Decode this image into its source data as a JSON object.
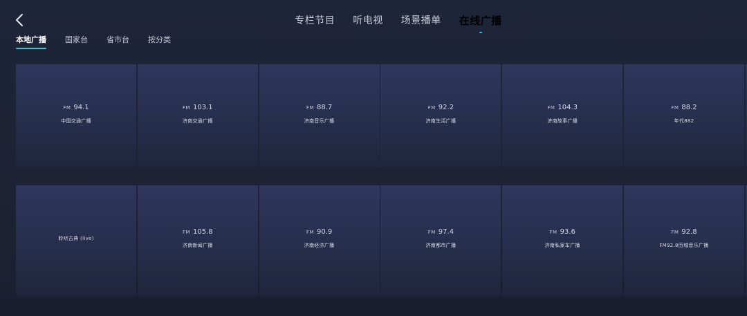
{
  "header": {
    "back_icon": "chevron-left-icon",
    "tabs": [
      {
        "label": "专栏节目",
        "active": false
      },
      {
        "label": "听电视",
        "active": false
      },
      {
        "label": "场景播单",
        "active": false
      },
      {
        "label": "在线广播",
        "active": true
      }
    ]
  },
  "subtabs": [
    {
      "label": "本地广播",
      "active": true
    },
    {
      "label": "国家台",
      "active": false
    },
    {
      "label": "省市台",
      "active": false
    },
    {
      "label": "按分类",
      "active": false
    }
  ],
  "stations": [
    {
      "prefix": "FM",
      "freq": "94.1",
      "name": "中国交通广播"
    },
    {
      "prefix": "FM",
      "freq": "103.1",
      "name": "济南交通广播"
    },
    {
      "prefix": "FM",
      "freq": "88.7",
      "name": "济南音乐广播"
    },
    {
      "prefix": "FM",
      "freq": "92.2",
      "name": "济南生活广播"
    },
    {
      "prefix": "FM",
      "freq": "104.3",
      "name": "济南故事广播"
    },
    {
      "prefix": "FM",
      "freq": "88.2",
      "name": "年代882"
    },
    {
      "prefix": "",
      "freq": "",
      "name": "聆听古典 (live)"
    },
    {
      "prefix": "FM",
      "freq": "105.8",
      "name": "济南新闻广播"
    },
    {
      "prefix": "FM",
      "freq": "90.9",
      "name": "济南经济广播"
    },
    {
      "prefix": "FM",
      "freq": "97.4",
      "name": "济南都市广播"
    },
    {
      "prefix": "FM",
      "freq": "93.6",
      "name": "济南私家车广播"
    },
    {
      "prefix": "FM",
      "freq": "92.8",
      "name": "FM92.8历城音乐广播"
    }
  ],
  "colors": {
    "accent": "#3fc1d6",
    "background": "#1d2235",
    "card_top": "#2e375b",
    "card_bottom": "#1f263c"
  }
}
